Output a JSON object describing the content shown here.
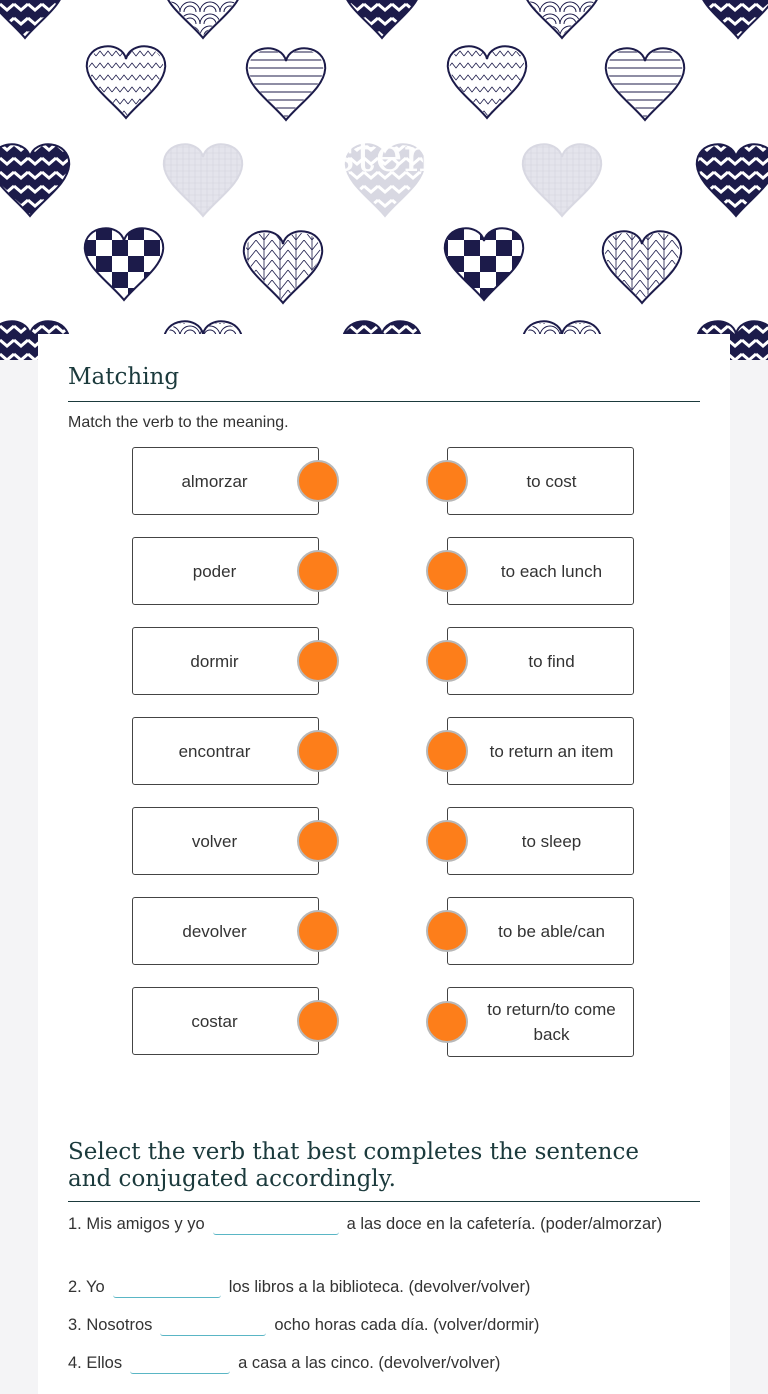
{
  "banner": {
    "title_fragments": "o  e   stem   ng",
    "heart_color": "#1c1b4a"
  },
  "matching": {
    "title": "Matching",
    "instruction": "Match the verb to the meaning.",
    "left_items": [
      "almorzar",
      "poder",
      "dormir",
      "encontrar",
      "volver",
      "devolver",
      "costar"
    ],
    "right_items": [
      "to cost",
      "to each lunch",
      "to find",
      "to return an item",
      "to sleep",
      "to be able/can",
      "to return/to come back"
    ],
    "dot_color": "#fd7e1a"
  },
  "fill_in": {
    "title": "Select the verb that best completes the sentence and conjugated accordingly.",
    "questions": [
      {
        "before": "1. Mis amigos y yo",
        "after": "a las doce en la cafetería. (poder/almorzar)",
        "value": ""
      },
      {
        "before": "2. Yo",
        "after": "los libros a la biblioteca. (devolver/volver)",
        "value": ""
      },
      {
        "before": "3. Nosotros",
        "after": "ocho horas cada día. (volver/dormir)",
        "value": ""
      },
      {
        "before": "4. Ellos",
        "after": "a casa a las cinco. (devolver/volver)",
        "value": ""
      }
    ]
  }
}
